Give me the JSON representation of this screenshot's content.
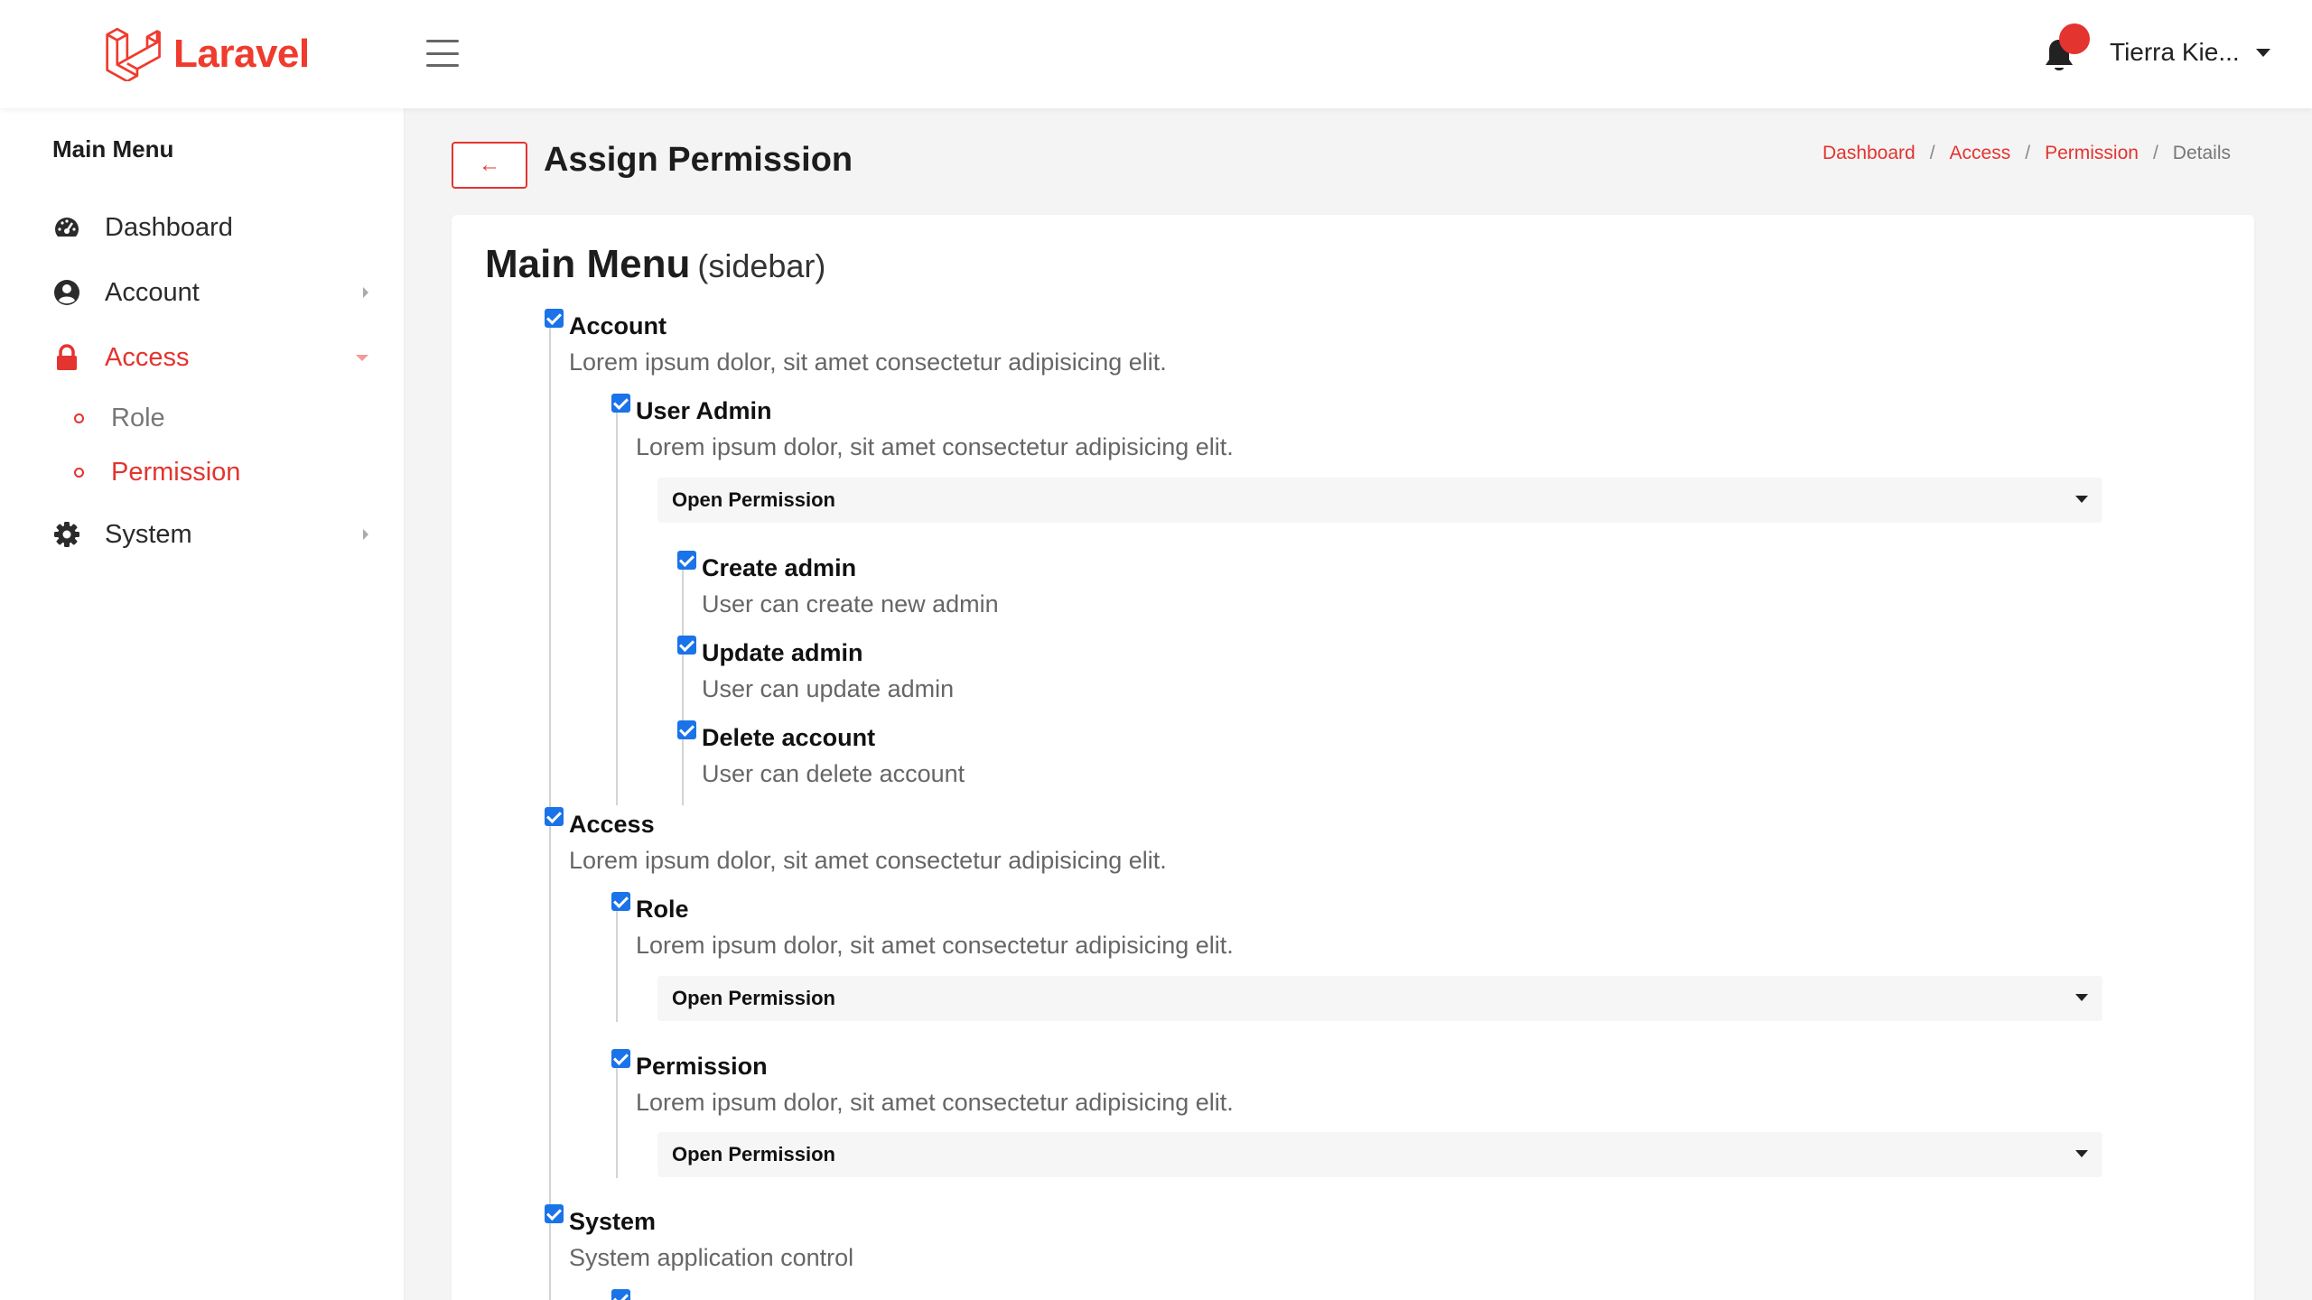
{
  "brand": {
    "name": "Laravel",
    "color": "#ef3b2d"
  },
  "header": {
    "user_name": "Tierra Kie...",
    "notification_icon": "bell-icon"
  },
  "sidebar": {
    "title": "Main Menu",
    "items": [
      {
        "label": "Dashboard",
        "icon": "gauge-icon"
      },
      {
        "label": "Account",
        "icon": "user-circle-icon"
      },
      {
        "label": "Access",
        "icon": "lock-icon"
      },
      {
        "label": "System",
        "icon": "gear-icon"
      }
    ],
    "access_children": [
      {
        "label": "Role"
      },
      {
        "label": "Permission"
      }
    ],
    "active_item": "Access",
    "active_child": "Permission"
  },
  "page": {
    "back_label": "←",
    "title": "Assign Permission",
    "breadcrumb": [
      "Dashboard",
      "Access",
      "Permission",
      "Details"
    ]
  },
  "card": {
    "heading": "Main Menu",
    "heading_sub": "(sidebar)",
    "open_permission_label": "Open Permission",
    "groups": [
      {
        "name": "Account",
        "desc": "Lorem ipsum dolor, sit amet consectetur adipisicing elit.",
        "checked": true,
        "children": [
          {
            "name": "User Admin",
            "desc": "Lorem ipsum dolor, sit amet consectetur adipisicing elit.",
            "checked": true,
            "permissions": [
              {
                "name": "Create admin",
                "desc": "User can create new admin",
                "checked": true
              },
              {
                "name": "Update admin",
                "desc": "User can update admin",
                "checked": true
              },
              {
                "name": "Delete account",
                "desc": "User can delete account",
                "checked": true
              }
            ]
          }
        ]
      },
      {
        "name": "Access",
        "desc": "Lorem ipsum dolor, sit amet consectetur adipisicing elit.",
        "checked": true,
        "children": [
          {
            "name": "Role",
            "desc": "Lorem ipsum dolor, sit amet consectetur adipisicing elit.",
            "checked": true
          },
          {
            "name": "Permission",
            "desc": "Lorem ipsum dolor, sit amet consectetur adipisicing elit.",
            "checked": true
          }
        ]
      },
      {
        "name": "System",
        "desc": "System application control",
        "checked": true
      }
    ]
  }
}
